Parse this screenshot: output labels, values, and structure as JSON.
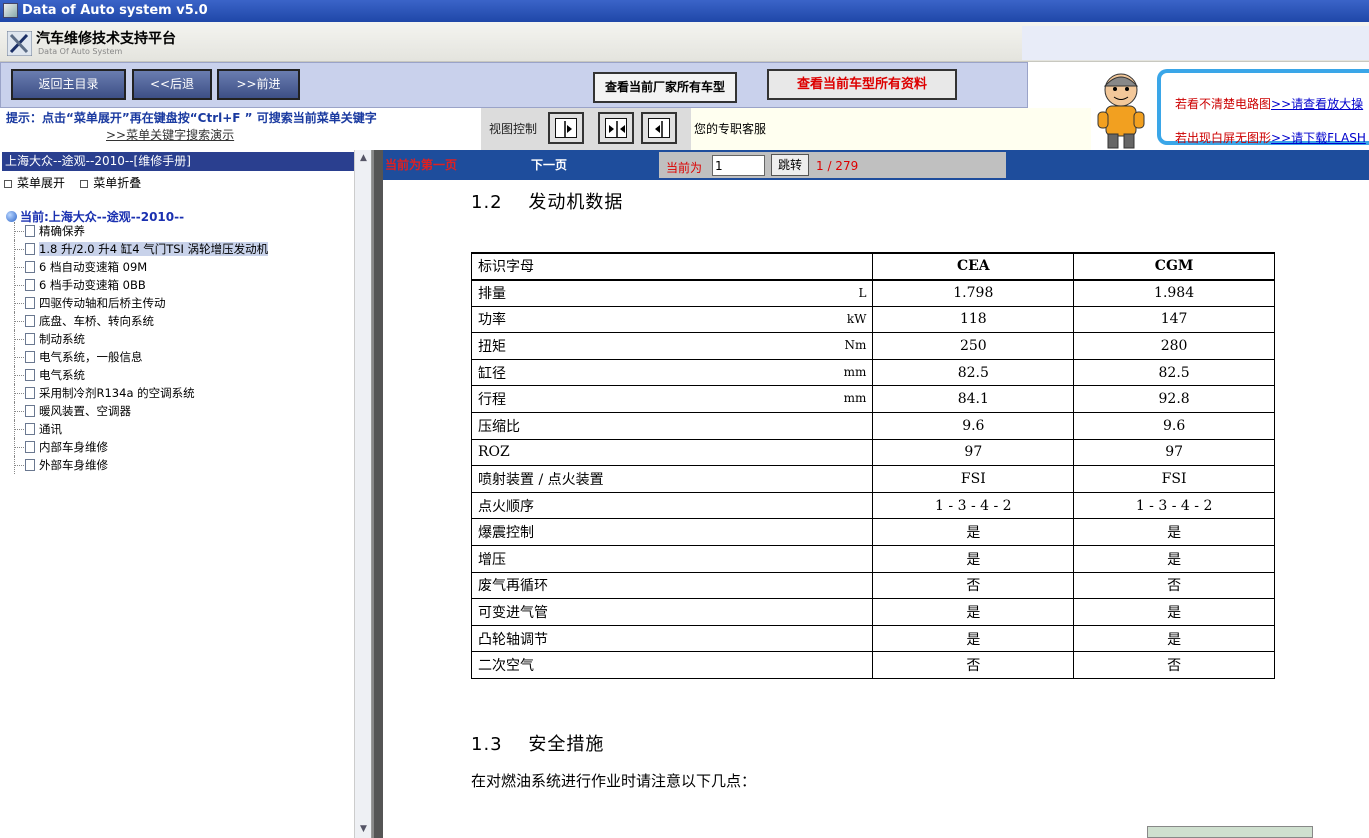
{
  "window": {
    "title": "Data of Auto system v5.0"
  },
  "header": {
    "title": "汽车维修技术支持平台",
    "subtitle": "Data Of Auto System"
  },
  "toolbar": {
    "back_menu": "返回主目录",
    "back": "<<后退",
    "forward": ">>前进",
    "view_models": "查看当前厂家所有车型",
    "view_all": "查看当前车型所有资料"
  },
  "ad": {
    "line1_text": "若看不清楚电路图",
    "line1_link": ">>请查看放大操",
    "line2_text": "若出现白屏无图形",
    "line2_link": ">>请下载FLASH"
  },
  "hint": {
    "tip": "提示：点击“菜单展开”再在键盘按“Ctrl+F ” 可搜索当前菜单关键字",
    "tip_link": ">>菜单关键字搜索演示",
    "view_label": "视图控制",
    "service": "您的专职客服"
  },
  "left": {
    "vehicle": "上海大众--途观--2010--[维修手册]",
    "expand": "菜单展开",
    "collapse": "菜单折叠",
    "root": "当前:上海大众--途观--2010--",
    "items": [
      "精确保养",
      "1.8 升/2.0 升4 缸4 气门TSI 涡轮增压发动机",
      "6 档自动变速箱 09M",
      "6 档手动变速箱 0BB",
      "四驱传动轴和后桥主传动",
      "底盘、车桥、转向系统",
      "制动系统",
      "电气系统，一般信息",
      "电气系统",
      "采用制冷剂R134a 的空调系统",
      "暖风装置、空调器",
      "通讯",
      "内部车身维修",
      "外部车身维修"
    ]
  },
  "nav": {
    "current_first": "当前为第一页",
    "next": "下一页",
    "current_label": "当前为",
    "page_value": "1",
    "go": "跳转",
    "total": "1 / 279"
  },
  "doc": {
    "section1": "1.2　 发动机数据",
    "section2": "1.3　 安全措施",
    "paragraph": "在对燃油系统进行作业时请注意以下几点：",
    "table": {
      "headers": [
        "标识字母",
        "CEA",
        "CGM"
      ],
      "rows": [
        {
          "name": "排量",
          "unit": "L",
          "cea": "1.798",
          "cgm": "1.984"
        },
        {
          "name": "功率",
          "unit": "kW",
          "cea": "118",
          "cgm": "147"
        },
        {
          "name": "扭矩",
          "unit": "Nm",
          "cea": "250",
          "cgm": "280"
        },
        {
          "name": "缸径",
          "unit": "mm",
          "cea": "82.5",
          "cgm": "82.5"
        },
        {
          "name": "行程",
          "unit": "mm",
          "cea": "84.1",
          "cgm": "92.8"
        },
        {
          "name": "压缩比",
          "unit": "",
          "cea": "9.6",
          "cgm": "9.6"
        },
        {
          "name": "ROZ",
          "unit": "",
          "cea": "97",
          "cgm": "97"
        },
        {
          "name": "喷射装置 / 点火装置",
          "unit": "",
          "cea": "FSI",
          "cgm": "FSI"
        },
        {
          "name": "点火顺序",
          "unit": "",
          "cea": "1 - 3 - 4 - 2",
          "cgm": "1 - 3 - 4 - 2"
        },
        {
          "name": "爆震控制",
          "unit": "",
          "cea": "是",
          "cgm": "是"
        },
        {
          "name": "增压",
          "unit": "",
          "cea": "是",
          "cgm": "是"
        },
        {
          "name": "废气再循环",
          "unit": "",
          "cea": "否",
          "cgm": "否"
        },
        {
          "name": "可变进气管",
          "unit": "",
          "cea": "是",
          "cgm": "是"
        },
        {
          "name": "凸轮轴调节",
          "unit": "",
          "cea": "是",
          "cgm": "是"
        },
        {
          "name": "二次空气",
          "unit": "",
          "cea": "否",
          "cgm": "否"
        }
      ]
    }
  },
  "colors": {
    "accent": "#1e4d9c",
    "alert": "#e02020",
    "toolbar_bg": "#c9d1ec"
  }
}
